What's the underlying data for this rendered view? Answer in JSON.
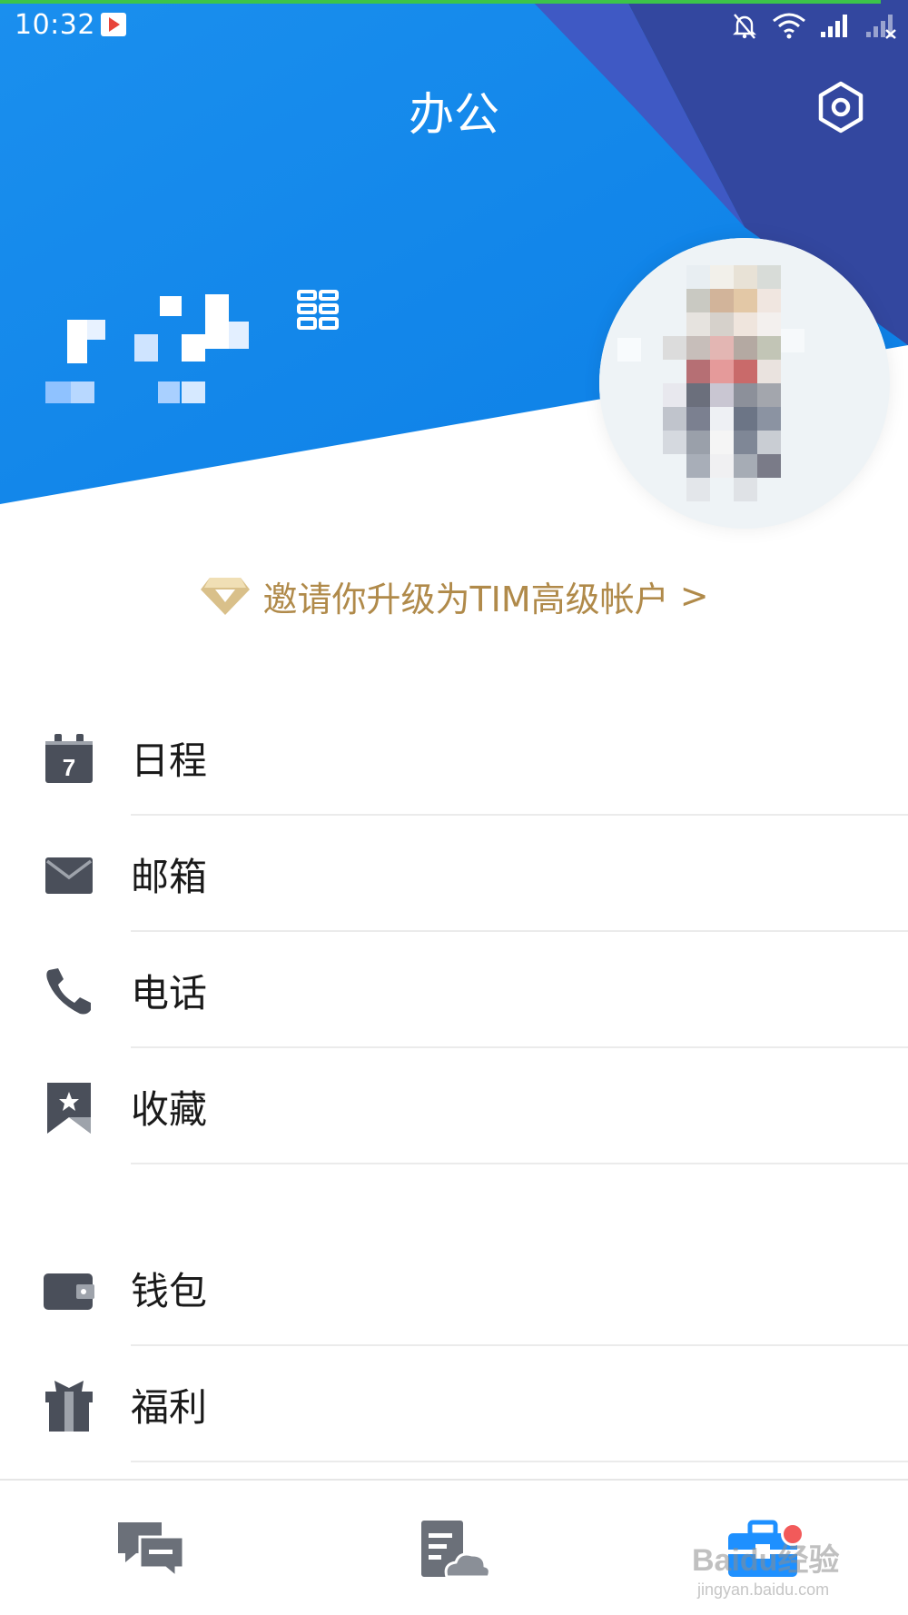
{
  "status_bar": {
    "time": "10:32",
    "icons": [
      "play-store-icon",
      "mute-bell-icon",
      "wifi-icon",
      "signal-icon",
      "no-signal-icon"
    ]
  },
  "header": {
    "title": "办公",
    "settings_icon": "hexagon-settings-icon",
    "qr_icon": "qr-code-icon"
  },
  "upgrade": {
    "text": "邀请你升级为TIM高级帐户",
    "chevron": ">",
    "icon": "diamond-icon",
    "color": "#b08a4a"
  },
  "menu_groups": [
    [
      {
        "label": "日程",
        "icon": "calendar-icon"
      },
      {
        "label": "邮箱",
        "icon": "mail-icon"
      },
      {
        "label": "电话",
        "icon": "phone-icon"
      },
      {
        "label": "收藏",
        "icon": "bookmark-icon"
      }
    ],
    [
      {
        "label": "钱包",
        "icon": "wallet-icon"
      },
      {
        "label": "福利",
        "icon": "gift-icon"
      }
    ]
  ],
  "tabbar": {
    "tabs": [
      {
        "icon": "messages-icon",
        "active": false
      },
      {
        "icon": "cloud-doc-icon",
        "active": false
      },
      {
        "icon": "office-toolbox-icon",
        "active": true
      }
    ],
    "badge_color": "#f25a5a"
  },
  "watermark": {
    "brand": "Baidu经验",
    "url": "jingyan.baidu.com"
  },
  "colors": {
    "header_blue": "#0f86ec",
    "header_dark": "#3a4aa8",
    "icon_gray": "#4a4f5a",
    "active_blue": "#1e90ff"
  }
}
